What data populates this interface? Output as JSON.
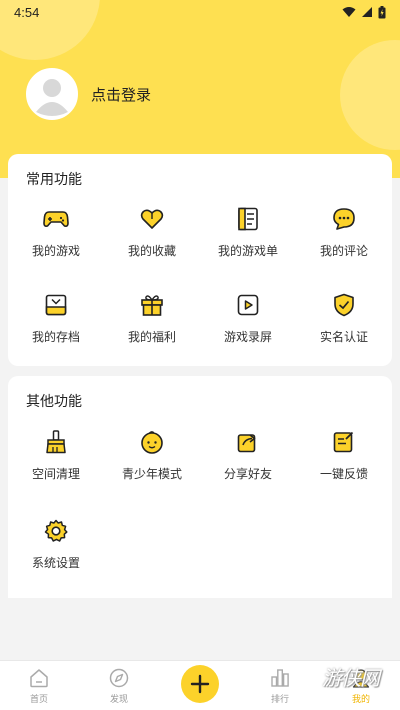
{
  "status_bar": {
    "time": "4:54"
  },
  "profile": {
    "login_text": "点击登录"
  },
  "common_functions": {
    "title": "常用功能",
    "items": [
      {
        "label": "我的游戏",
        "icon": "gamepad-icon"
      },
      {
        "label": "我的收藏",
        "icon": "heart-icon"
      },
      {
        "label": "我的游戏单",
        "icon": "list-doc-icon"
      },
      {
        "label": "我的评论",
        "icon": "comment-icon"
      },
      {
        "label": "我的存档",
        "icon": "archive-icon"
      },
      {
        "label": "我的福利",
        "icon": "gift-icon"
      },
      {
        "label": "游戏录屏",
        "icon": "record-icon"
      },
      {
        "label": "实名认证",
        "icon": "shield-check-icon"
      }
    ]
  },
  "other_functions": {
    "title": "其他功能",
    "items": [
      {
        "label": "空间清理",
        "icon": "broom-icon"
      },
      {
        "label": "青少年模式",
        "icon": "child-face-icon"
      },
      {
        "label": "分享好友",
        "icon": "share-icon"
      },
      {
        "label": "一键反馈",
        "icon": "feedback-icon"
      },
      {
        "label": "系统设置",
        "icon": "gear-icon"
      }
    ]
  },
  "bottom_nav": {
    "items": [
      {
        "label": "首页",
        "icon": "home-icon"
      },
      {
        "label": "发现",
        "icon": "compass-icon"
      },
      {
        "label": "",
        "icon": "plus-icon"
      },
      {
        "label": "排行",
        "icon": "bar-chart-icon"
      },
      {
        "label": "我的",
        "icon": "user-icon"
      }
    ]
  },
  "watermark": "游侠网",
  "colors": {
    "accent": "#fee051",
    "fab": "#fcd22a",
    "active": "#f0b400"
  }
}
